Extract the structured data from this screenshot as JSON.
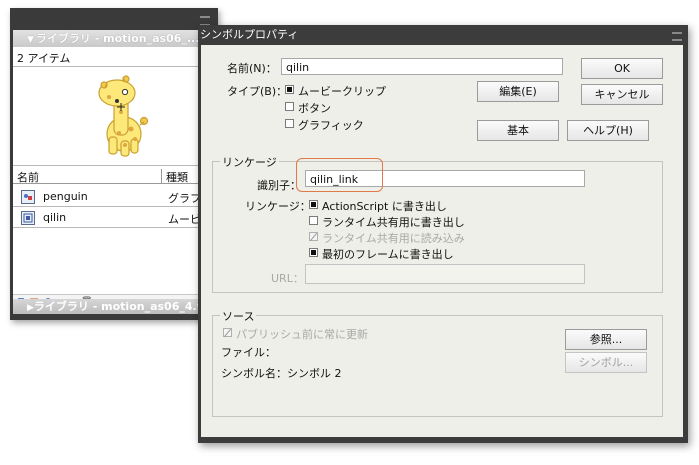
{
  "library": {
    "title": "ライブラリ - motion_as06_...",
    "count": "2 アイテム",
    "columns": {
      "name": "名前",
      "kind": "種類"
    },
    "items": [
      {
        "name": "penguin",
        "kind": "グラフ",
        "icon": "graphic-symbol-icon"
      },
      {
        "name": "qilin",
        "kind": "ムービ",
        "icon": "movieclip-symbol-icon"
      }
    ],
    "title2": "ライブラリ - motion_as06_4.fl..."
  },
  "dialog": {
    "title": "シンボルプロパティ",
    "name_label": "名前(N)：",
    "name_value": "qilin",
    "type_label": "タイプ(B)：",
    "type_options": [
      {
        "label": "ムービークリップ",
        "selected": true
      },
      {
        "label": "ボタン",
        "selected": false
      },
      {
        "label": "グラフィック",
        "selected": false
      }
    ],
    "buttons": {
      "ok": "OK",
      "cancel": "キャンセル",
      "edit": "編集(E)",
      "basic": "基本",
      "help": "ヘルプ(H)"
    },
    "linkage": {
      "group_title": "リンケージ",
      "identifier_label": "識別子：",
      "identifier_value": "qilin_link",
      "linkage_label": "リンケージ：",
      "options": [
        {
          "label": "ActionScript に書き出し",
          "checked": true,
          "enabled": true
        },
        {
          "label": "ランタイム共有用に書き出し",
          "checked": false,
          "enabled": true
        },
        {
          "label": "ランタイム共有用に読み込み",
          "checked": false,
          "enabled": false
        },
        {
          "label": "最初のフレームに書き出し",
          "checked": true,
          "enabled": true
        }
      ],
      "url_label": "URL："
    },
    "source": {
      "group_title": "ソース",
      "always_update": "パブリッシュ前に常に更新",
      "file_label": "ファイル：",
      "symbol_name": "シンボル名：シンボル 2",
      "browse_button": "参照...",
      "symbol_button": "シンボル..."
    }
  },
  "colors": {
    "highlight": "#e07a4a",
    "dialog_bg": "#efefe9",
    "frame": "#3c3c3c"
  }
}
